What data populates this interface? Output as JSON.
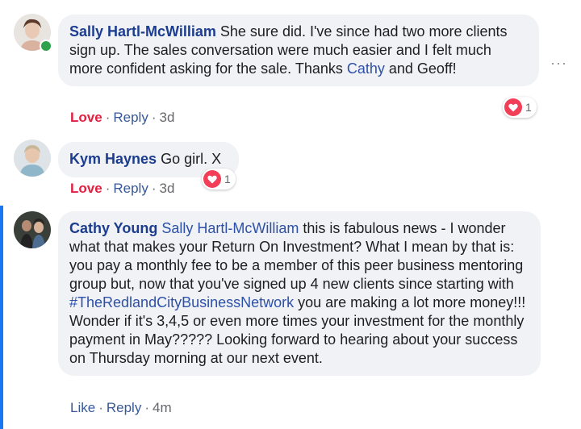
{
  "comments": [
    {
      "author": "Sally Hartl-McWilliam",
      "text_part1": "She sure did. I've since had two more clients sign up. The sales conversation were much easier and I felt much more confident asking for the sale. Thanks ",
      "mention": "Cathy",
      "text_part2": " and Geoff!",
      "love_label": "Love",
      "reply_label": "Reply",
      "time": "3d",
      "reaction_count": "1",
      "reaction_icon": "heart-icon"
    },
    {
      "author": "Kym Haynes",
      "text": "Go girl. X",
      "love_label": "Love",
      "reply_label": "Reply",
      "time": "3d",
      "reaction_count": "1",
      "reaction_icon": "heart-icon"
    },
    {
      "author": "Cathy Young",
      "mention": "Sally Hartl-McWilliam",
      "text_part1": " this is fabulous news - I wonder what that makes your Return On Investment? What I mean by that is: you pay a monthly fee to be a member of this peer business mentoring group but, now that you've signed up 4 new clients since starting with ",
      "hashtag": "#TheRedlandCityBusinessNetwork",
      "text_part2": " you are making a lot more money!!! Wonder if it's 3,4,5 or even more times your investment for the monthly payment in May????? Looking forward to hearing about your success on Thursday morning at our next event.",
      "like_label": "Like",
      "reply_label": "Reply",
      "time": "4m"
    }
  ],
  "more_options_label": "···",
  "colors": {
    "accent": "#1877f2",
    "love": "#e41e3f",
    "bubble": "#f0f2f5",
    "name": "#1c3d8f"
  }
}
